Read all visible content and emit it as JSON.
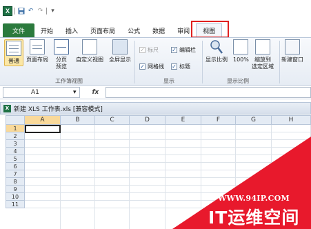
{
  "quick_access": {
    "app_icon": "excel-logo-icon",
    "save_icon": "save-icon",
    "undo_icon": "undo-icon",
    "redo_icon": "redo-icon",
    "customize_icon": "customize-icon"
  },
  "tabs": [
    {
      "label": "文件",
      "kind": "file"
    },
    {
      "label": "开始"
    },
    {
      "label": "插入"
    },
    {
      "label": "页面布局"
    },
    {
      "label": "公式"
    },
    {
      "label": "数据"
    },
    {
      "label": "审阅"
    },
    {
      "label": "视图",
      "active": true
    }
  ],
  "ribbon": {
    "workbook_views": {
      "label": "工作簿视图",
      "buttons": {
        "normal": "普通",
        "page_layout": "页面布局",
        "page_break": "分页\n预览",
        "custom_view": "自定义视图",
        "full_screen": "全屏显示"
      }
    },
    "show": {
      "label": "显示",
      "ruler": "标尺",
      "formula_bar": "编辑栏",
      "gridlines": "网格线",
      "headings": "标题"
    },
    "zoom": {
      "label": "显示比例",
      "zoom": "显示比例",
      "zoom100": "100%",
      "zoom_selection": "缩放到\n选定区域"
    },
    "window": {
      "new_window": "新建窗口"
    }
  },
  "formula_bar": {
    "name_box": "A1",
    "name_dropdown": "▾",
    "fx": "fx",
    "value": ""
  },
  "workbook": {
    "title": "新建 XLS 工作表.xls  [兼容模式]"
  },
  "sheet": {
    "columns": [
      "A",
      "B",
      "C",
      "D",
      "E",
      "F",
      "G",
      "H"
    ],
    "rows": [
      "1",
      "2",
      "3",
      "4",
      "5",
      "6",
      "7",
      "8",
      "9",
      "10",
      "11"
    ],
    "active_cell": "A1"
  },
  "watermark": {
    "url": "WWW.94IP.COM",
    "name": "IT运维空间"
  },
  "colors": {
    "file_tab": "#2b7a3d",
    "highlight_box": "#e02020",
    "watermark_red": "#e8192c",
    "selected_header": "#f9d99a"
  }
}
